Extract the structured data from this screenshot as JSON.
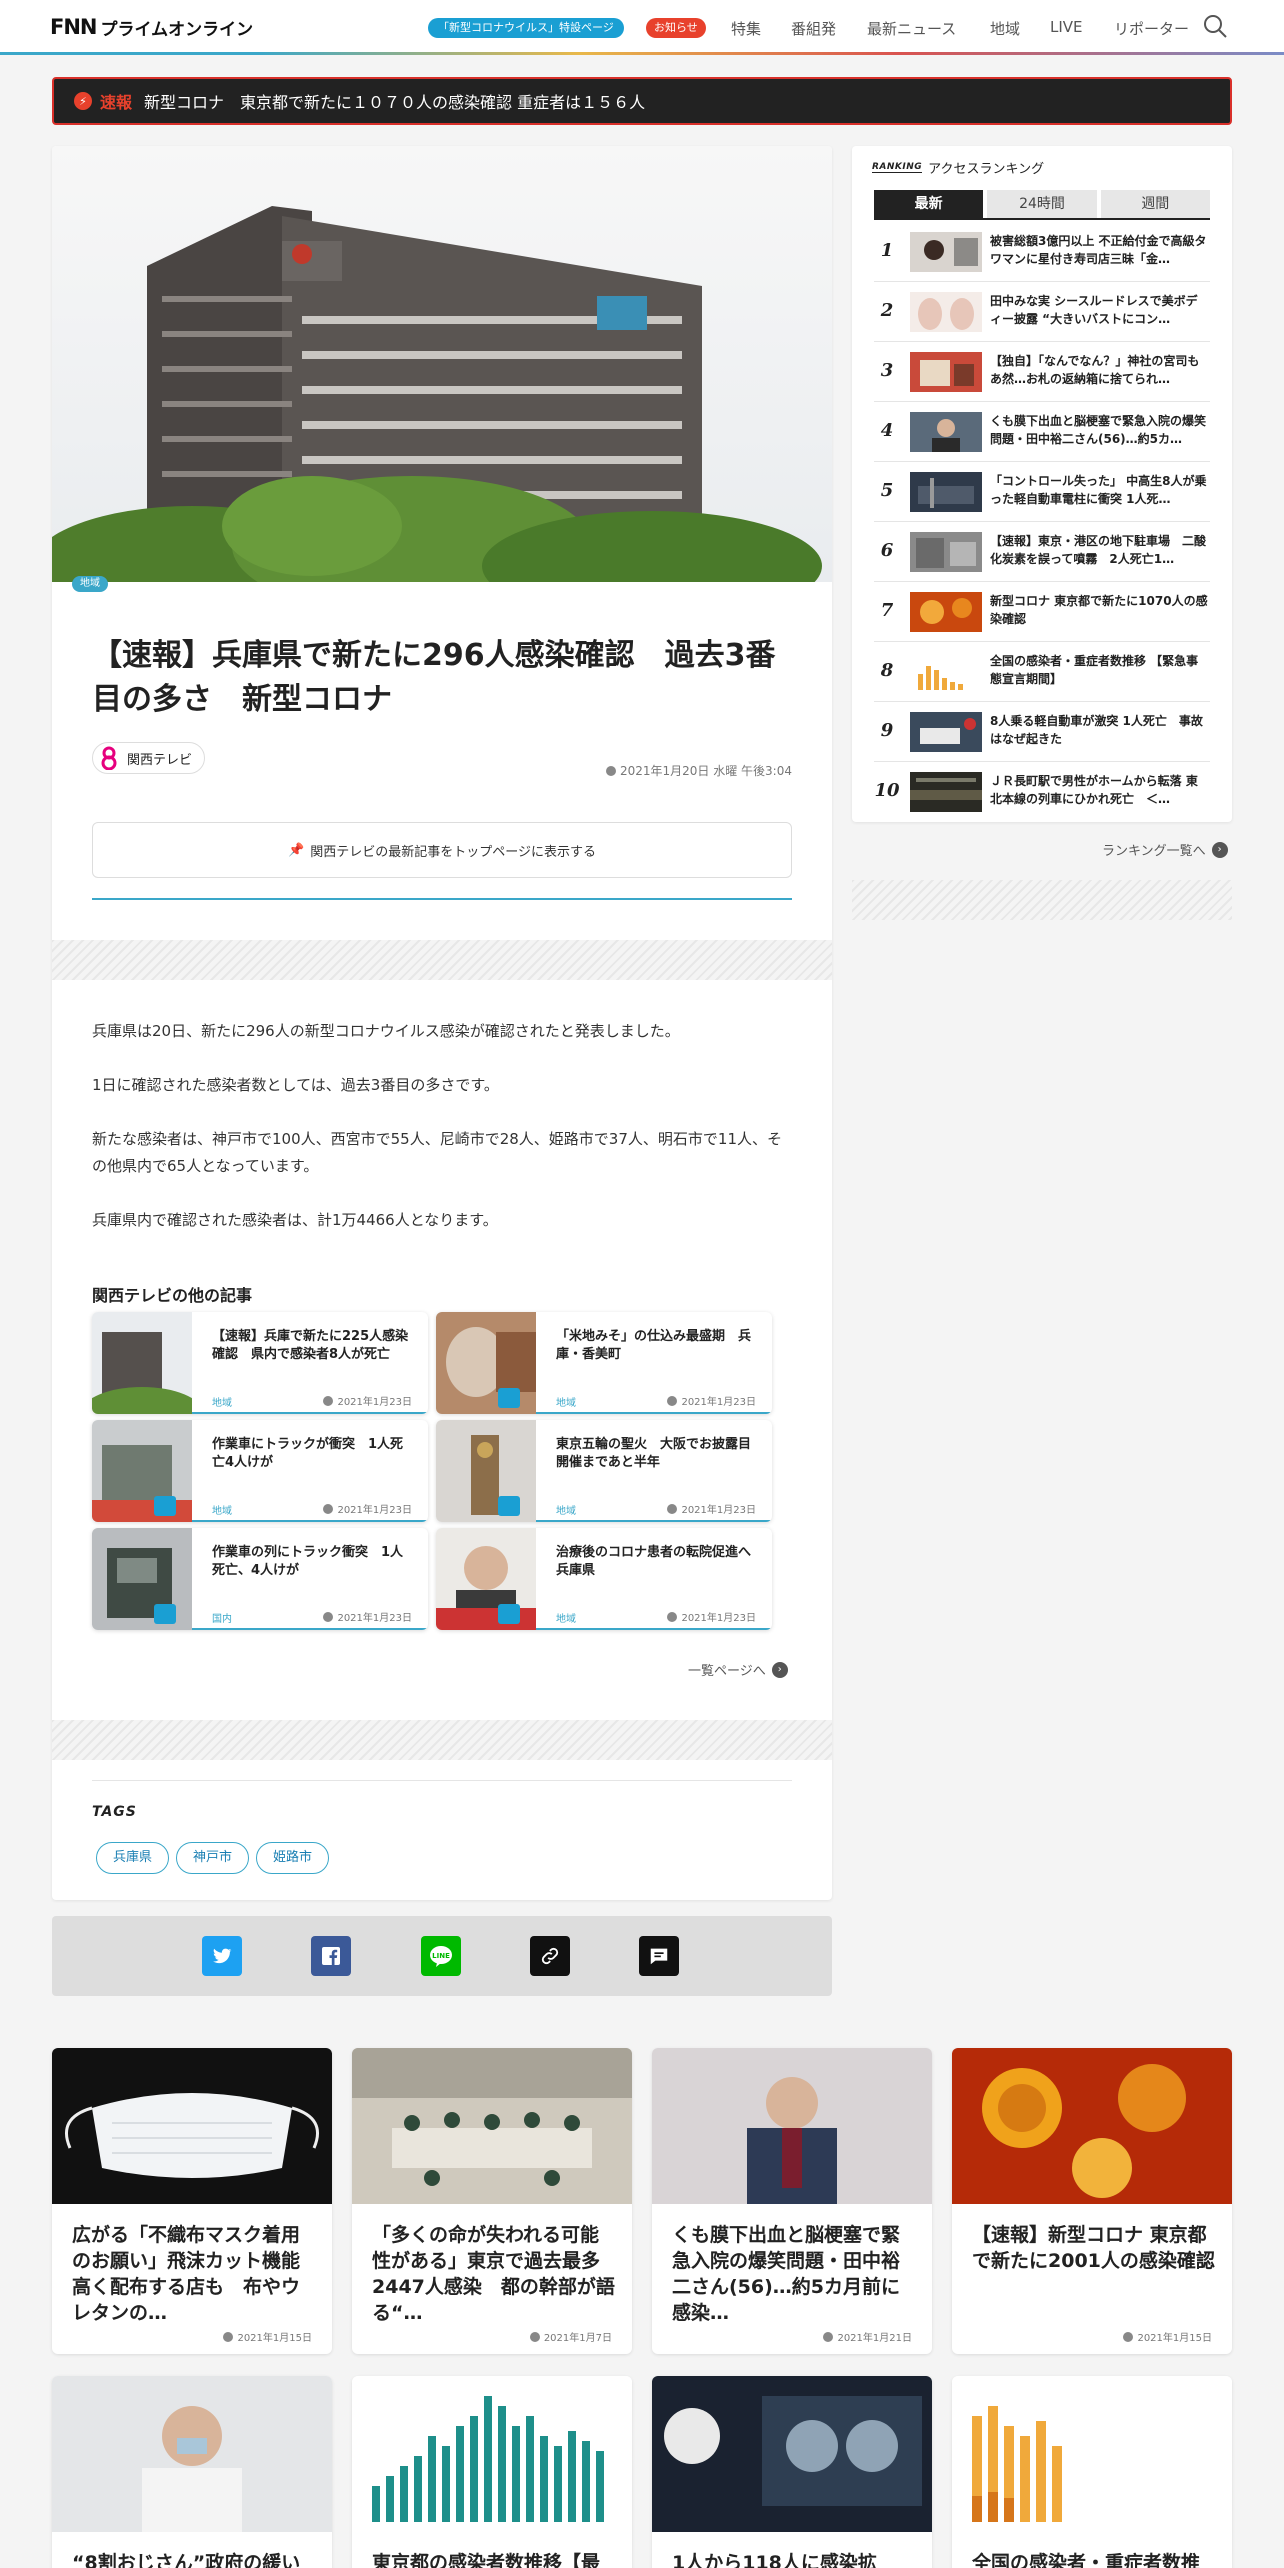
{
  "header": {
    "logo_fnn": "FNN",
    "logo_sub": "プライムオンライン",
    "corona_pill": "「新型コロナウイルス」特設ページ",
    "notice_pill": "お知らせ",
    "nav": [
      "特集",
      "番組発",
      "最新ニュース",
      "地域",
      "LIVE",
      "リポーター"
    ]
  },
  "breaking": {
    "label": "速報",
    "text": "新型コロナ　東京都で新たに１０７０人の感染確認 重症者は１５６人"
  },
  "article": {
    "category": "地域",
    "title": "【速報】兵庫県で新たに296人感染確認　過去3番目の多さ　新型コロナ",
    "source": "関西テレビ",
    "date": "2021年1月20日 水曜 午後3:04",
    "pin_button": "関西テレビの最新記事をトップページに表示する",
    "paragraphs": [
      "兵庫県は20日、新たに296人の新型コロナウイルス感染が確認されたと発表しました。",
      "1日に確認された感染者数としては、過去3番目の多さです。",
      "新たな感染者は、神戸市で100人、西宮市で55人、尼崎市で28人、姫路市で37人、明石市で11人、その他県内で65人となっています。",
      "兵庫県内で確認された感染者は、計1万4466人となります。"
    ],
    "other_title": "関西テレビの他の記事",
    "related": [
      {
        "title": "【速報】兵庫で新たに225人感染確認　県内で感染者8人が死亡",
        "category": "地域",
        "date": "2021年1月23日"
      },
      {
        "title": "「米地みそ」の仕込み最盛期　兵庫・香美町",
        "category": "地域",
        "date": "2021年1月23日"
      },
      {
        "title": "作業車にトラックが衝突　1人死亡4人けが",
        "category": "地域",
        "date": "2021年1月23日"
      },
      {
        "title": "東京五輪の聖火　大阪でお披露目　開催まであと半年",
        "category": "地域",
        "date": "2021年1月23日"
      },
      {
        "title": "作業車の列にトラック衝突　1人死亡、4人けが",
        "category": "国内",
        "date": "2021年1月23日"
      },
      {
        "title": "治療後のコロナ患者の転院促進へ　兵庫県",
        "category": "地域",
        "date": "2021年1月23日"
      }
    ],
    "more_link": "一覧ページへ",
    "tags_title": "TAGS",
    "tags": [
      "兵庫県",
      "神戸市",
      "姫路市"
    ]
  },
  "ranking": {
    "title": "アクセスランキング",
    "label_small": "RANKING",
    "tabs": [
      "最新",
      "24時間",
      "週間"
    ],
    "items": [
      {
        "num": "1",
        "text": "被害総額3億円以上 不正給付金で高級タワマンに星付き寿司店三昧「金…"
      },
      {
        "num": "2",
        "text": "田中みな実 シースルードレスで美ボディー披露 “大きいバストにコン…"
      },
      {
        "num": "3",
        "text": "【独自】「なんでなん？」神社の宮司もあ然…お札の返納箱に捨てられ…"
      },
      {
        "num": "4",
        "text": "くも膜下出血と脳梗塞で緊急入院の爆笑問題・田中裕二さん(56)…約5カ…"
      },
      {
        "num": "5",
        "text": "「コントロール失った」 中高生8人が乗った軽自動車電柱に衝突 1人死…"
      },
      {
        "num": "6",
        "text": "【速報】東京・港区の地下駐車場　二酸化炭素を誤って噴霧　2人死亡1…"
      },
      {
        "num": "7",
        "text": "新型コロナ 東京都で新たに1070人の感染確認"
      },
      {
        "num": "8",
        "text": "全国の感染者・重症者数推移 【緊急事態宣言期間】"
      },
      {
        "num": "9",
        "text": "8人乗る軽自動車が激突 1人死亡　事故はなぜ起きた"
      },
      {
        "num": "10",
        "text": "ＪＲ長町駅で男性がホームから転落 東北本線の列車にひかれ死亡　＜…"
      }
    ],
    "more_link": "ランキング一覧へ"
  },
  "cards": [
    {
      "title": "広がる「不織布マスク着用のお願い」飛沫カット機能高く配布する店も　布やウレタンの…",
      "date": "2021年1月15日"
    },
    {
      "title": "「多くの命が失われる可能性がある」東京で過去最多2447人感染　都の幹部が語る“…",
      "date": "2021年1月7日"
    },
    {
      "title": "くも膜下出血と脳梗塞で緊急入院の爆笑問題・田中裕二さん(56)…約5カ月前に感染…",
      "date": "2021年1月21日"
    },
    {
      "title": "【速報】新型コロナ 東京都で新たに2001人の感染確認",
      "date": "2021年1月15日"
    },
    {
      "title": "“8割おじさん”政府の緩い",
      "date": ""
    },
    {
      "title": "東京都の感染者数推移【最",
      "date": ""
    },
    {
      "title": "1人から118人に感染拡",
      "date": ""
    },
    {
      "title": "全国の感染者・重症者数推",
      "date": ""
    }
  ]
}
